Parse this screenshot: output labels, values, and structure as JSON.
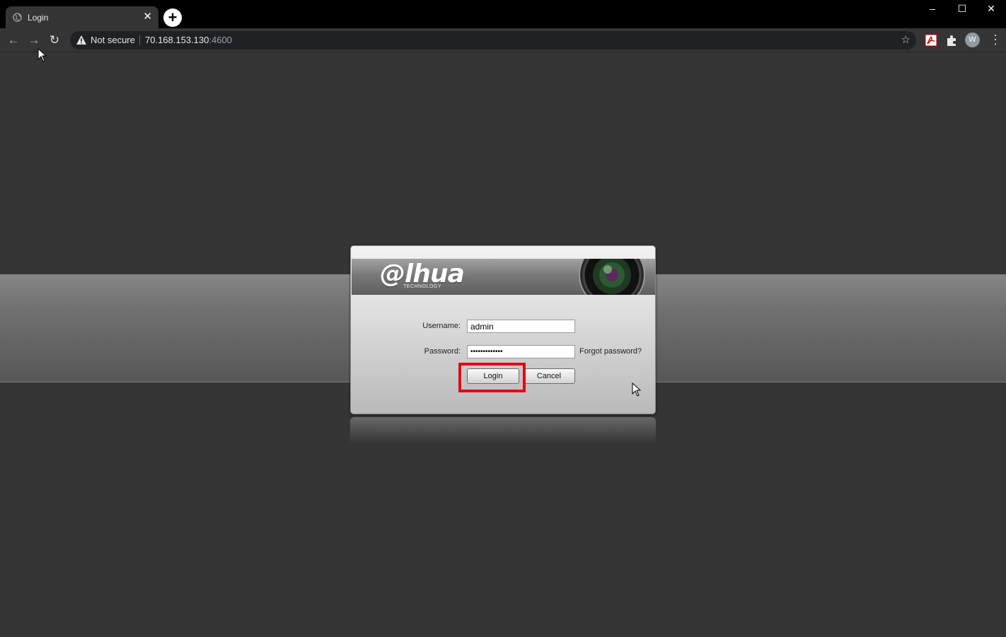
{
  "browser": {
    "tab_title": "Login",
    "tab_close": "✕",
    "new_tab": "+",
    "window_controls": {
      "minimize": "–",
      "maximize": "☐",
      "close": "✕"
    },
    "nav": {
      "back": "←",
      "forward": "→",
      "reload": "↻"
    },
    "address": {
      "security_label": "Not secure",
      "host": "70.168.153.130",
      "port": ":4600"
    },
    "profile_initial": "W",
    "menu": "⋮",
    "bookmark_star": "☆"
  },
  "dialog": {
    "brand": {
      "logo": "@lhua",
      "tagline": "TECHNOLOGY"
    },
    "username_label": "Username:",
    "username_value": "admin",
    "password_label": "Password:",
    "password_value": "•••••••••••••",
    "forgot_password": "Forgot password?",
    "login_button": "Login",
    "cancel_button": "Cancel",
    "highlight_color": "#e30613"
  }
}
